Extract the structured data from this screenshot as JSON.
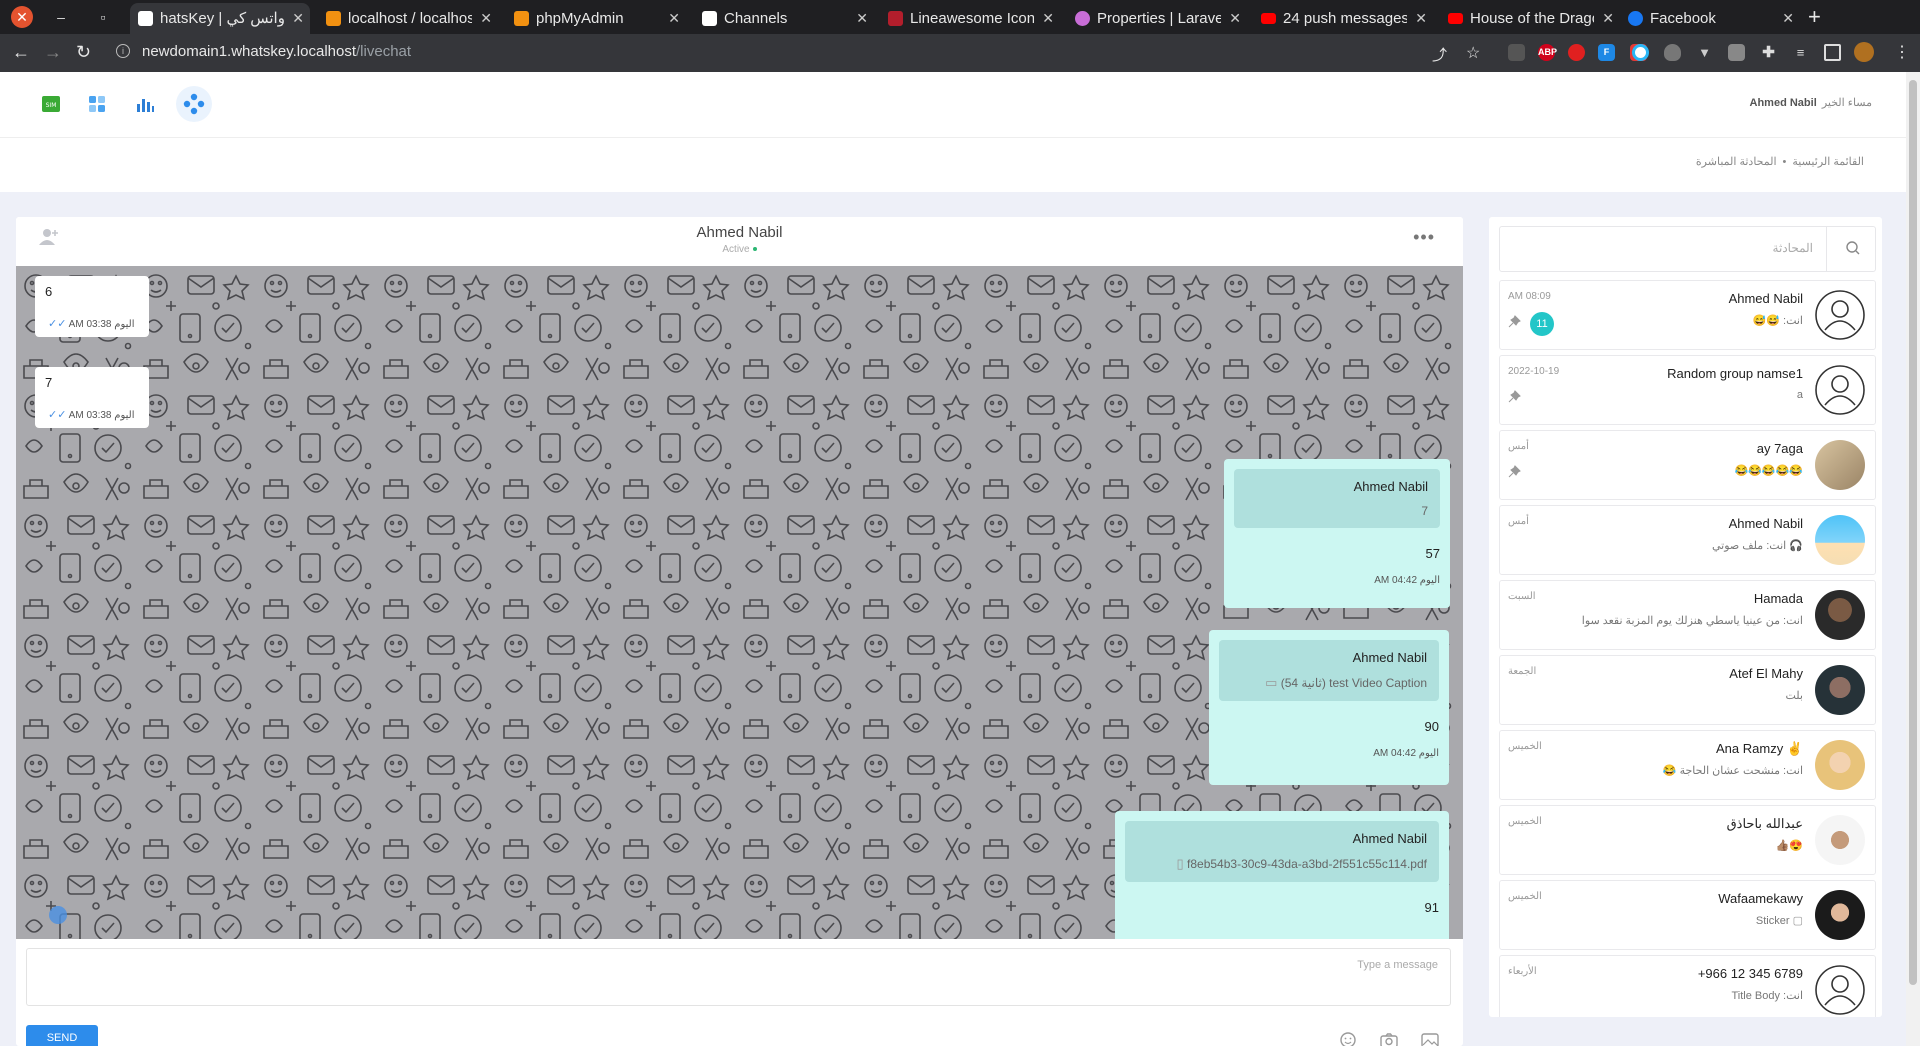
{
  "browser": {
    "tabs": [
      {
        "label": "hatsKey | واتس كي",
        "active": true,
        "favicon": "whatskey",
        "color": "#ffffff"
      },
      {
        "label": "localhost / localhost",
        "favicon": "phpmyadmin",
        "color": "#f29111"
      },
      {
        "label": "phpMyAdmin",
        "favicon": "phpmyadmin",
        "color": "#f29111"
      },
      {
        "label": "Channels",
        "favicon": "whatskey",
        "color": "#ffffff"
      },
      {
        "label": "Lineawesome Icons",
        "favicon": "lineawesome",
        "color": "#b31e2c"
      },
      {
        "label": "Properties | Laravel",
        "favicon": "github",
        "color": "#c86dd7"
      },
      {
        "label": "24 push messages",
        "favicon": "youtube",
        "color": "#ff0000"
      },
      {
        "label": "House of the Dragon",
        "favicon": "youtube",
        "color": "#ff0000"
      },
      {
        "label": "Facebook",
        "favicon": "facebook",
        "color": "#1877f2"
      }
    ],
    "url_host": "newdomain1.whatskey.localhost",
    "url_path": "/livechat"
  },
  "header": {
    "greeting": "مساء الخير",
    "user_name": "Ahmed Nabil",
    "breadcrumb": [
      "القائمة الرئيسية",
      "المحادثة المباشرة"
    ]
  },
  "chat": {
    "contact_name": "Ahmed Nabil",
    "status": "Active",
    "incoming": [
      {
        "text": "6",
        "time": "AM 03:38 اليوم"
      },
      {
        "text": "7",
        "time": "AM 03:38 اليوم"
      }
    ],
    "outgoing": [
      {
        "quote_sender": "Ahmed Nabil",
        "quote_text": "7",
        "text": "57",
        "time": "AM 04:42 اليوم"
      },
      {
        "quote_sender": "Ahmed Nabil",
        "quote_text": "(54 ثانية) test Video Caption",
        "text": "90",
        "time": "AM 04:42 اليوم"
      },
      {
        "quote_sender": "Ahmed Nabil",
        "quote_text": "f8eb54b3-30c9-43da-a3bd-2f551c55c114.pdf",
        "text": "91",
        "time": ""
      }
    ],
    "composer_placeholder": "Type a message",
    "send_label": "SEND"
  },
  "sidebar": {
    "search_placeholder": "المحادثة",
    "conversations": [
      {
        "name": "Ahmed Nabil",
        "preview": "انت: 😅😅",
        "time": "AM 08:09",
        "unread": "11",
        "pinned": true,
        "avatar": "default"
      },
      {
        "name": "Random group namse1",
        "preview": "a",
        "time": "2022-10-19",
        "pinned": true,
        "avatar": "default"
      },
      {
        "name": "ay 7aga",
        "preview": "😂😂😂😂😂",
        "time": "أمس",
        "pinned": true,
        "avatar": "photo-beige"
      },
      {
        "name": "Ahmed Nabil",
        "preview": "انت: ملف صوتي",
        "time": "أمس",
        "avatar": "photo-beach"
      },
      {
        "name": "Hamada",
        "preview": "انت: من عينيا ياسطي هنزلك يوم المزبة نقعد سوا",
        "time": "السبت",
        "avatar": "photo-dark"
      },
      {
        "name": "Atef El Mahy",
        "preview": "بلت",
        "time": "الجمعة",
        "avatar": "photo-dark2"
      },
      {
        "name": "Ana Ramzy ✌️",
        "preview": "انت: منشحت عشان الحاجة 😂",
        "time": "الخميس",
        "avatar": "photo-blonde"
      },
      {
        "name": "عبدالله باحاذق",
        "preview": "😍👍🏽",
        "time": "الخميس",
        "avatar": "photo-white"
      },
      {
        "name": "Wafaamekawy",
        "preview": "Sticker",
        "time": "الخميس",
        "avatar": "photo-hijab"
      },
      {
        "name": "+966 12 345 6789",
        "preview": "انت: Title Body",
        "time": "الأربعاء",
        "avatar": "default"
      }
    ]
  }
}
